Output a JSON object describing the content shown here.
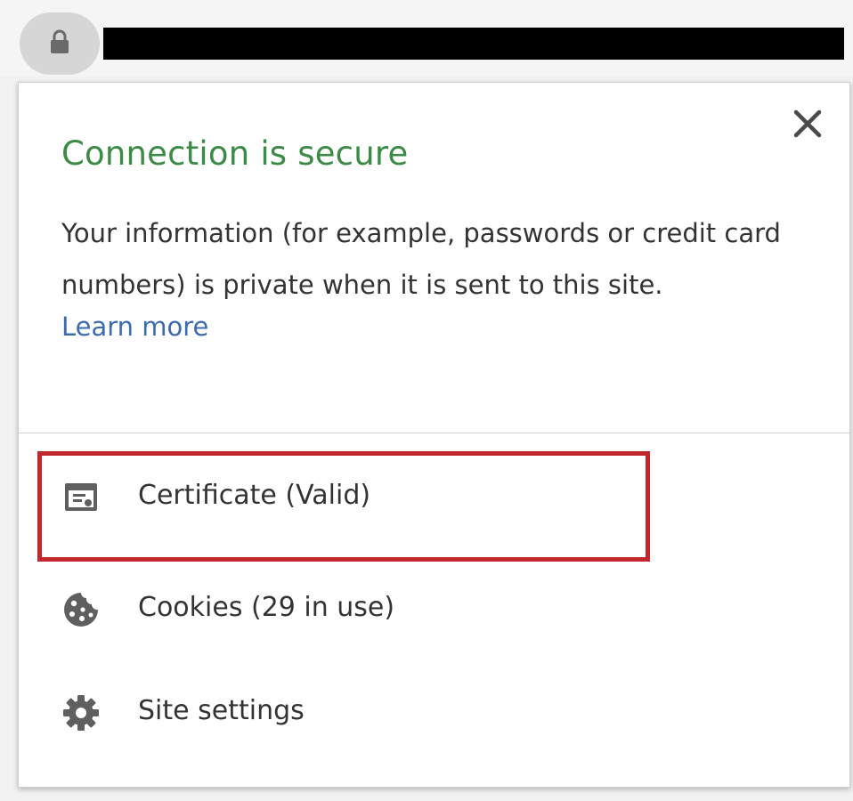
{
  "popup": {
    "title": "Connection is secure",
    "description": "Your information (for example, passwords or credit card numbers) is private when it is sent to this site.",
    "learn_more": "Learn more"
  },
  "items": [
    {
      "label": "Certificate (Valid)",
      "icon": "certificate-icon"
    },
    {
      "label": "Cookies (29 in use)",
      "icon": "cookie-icon"
    },
    {
      "label": "Site settings",
      "icon": "gear-icon"
    }
  ],
  "colors": {
    "title_green": "#3b8a45",
    "link_blue": "#3d6bb0",
    "highlight_red": "#c1272d"
  }
}
